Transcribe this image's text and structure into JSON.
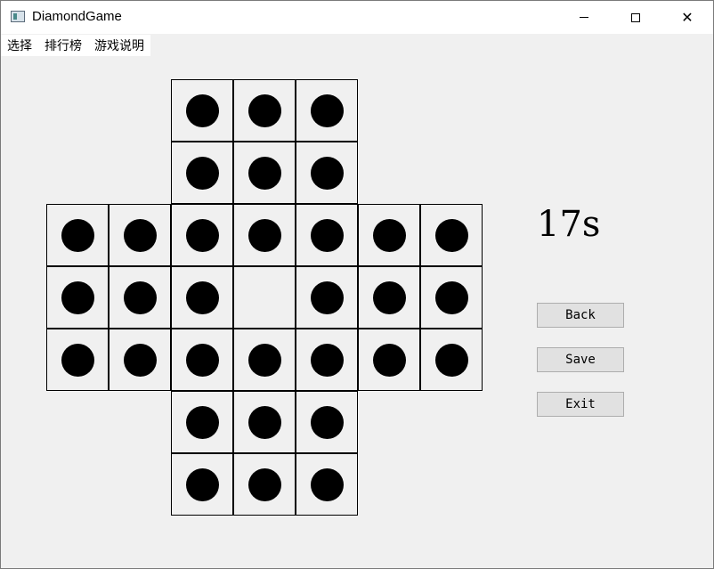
{
  "window": {
    "title": "DiamondGame",
    "app_icon": "window-app-icon"
  },
  "titlebar_controls": {
    "minimize": "minimize-icon",
    "maximize": "maximize-icon",
    "close": "close-icon",
    "close_glyph": "✕"
  },
  "menu": {
    "items": [
      {
        "label": "选择",
        "name": "menu-select"
      },
      {
        "label": "排行榜",
        "name": "menu-leaderboard"
      },
      {
        "label": "游戏说明",
        "name": "menu-instructions"
      }
    ]
  },
  "board": {
    "empty": [
      3,
      3
    ],
    "rows": [
      [
        null,
        null,
        true,
        true,
        true,
        null,
        null
      ],
      [
        null,
        null,
        true,
        true,
        true,
        null,
        null
      ],
      [
        true,
        true,
        true,
        true,
        true,
        true,
        true
      ],
      [
        true,
        true,
        true,
        false,
        true,
        true,
        true
      ],
      [
        true,
        true,
        true,
        true,
        true,
        true,
        true
      ],
      [
        null,
        null,
        true,
        true,
        true,
        null,
        null
      ],
      [
        null,
        null,
        true,
        true,
        true,
        null,
        null
      ]
    ],
    "colors": {
      "peg": "#000000",
      "background": "#f0f0f0"
    }
  },
  "timer": {
    "text": "17s"
  },
  "buttons": {
    "back": "Back",
    "save": "Save",
    "exit": "Exit"
  }
}
